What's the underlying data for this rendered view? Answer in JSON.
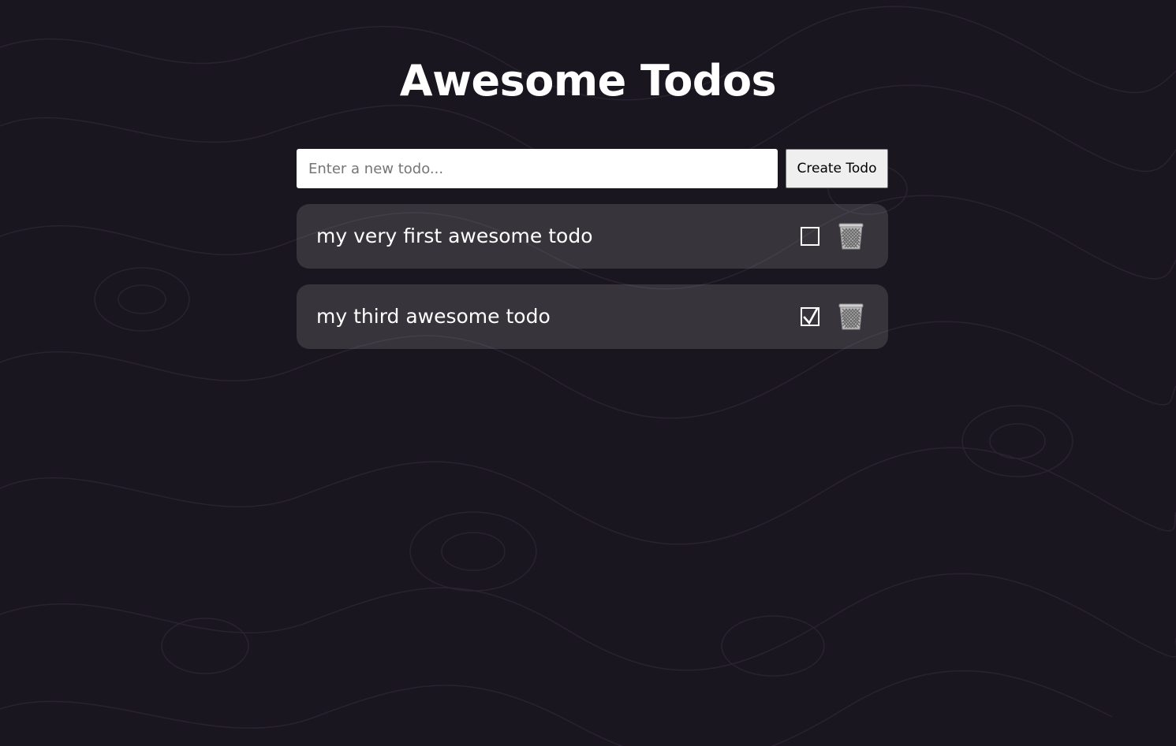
{
  "app": {
    "title": "Awesome Todos"
  },
  "form": {
    "input_placeholder": "Enter a new todo...",
    "input_value": "",
    "create_label": "Create Todo"
  },
  "todos": [
    {
      "text": "my very first awesome todo",
      "completed": false
    },
    {
      "text": "my third awesome todo",
      "completed": true
    }
  ],
  "icons": {
    "checkbox": "checkbox-icon",
    "delete": "trash-icon"
  },
  "colors": {
    "background": "#1a1620",
    "card": "#ffffff21",
    "text": "#ffffff"
  }
}
